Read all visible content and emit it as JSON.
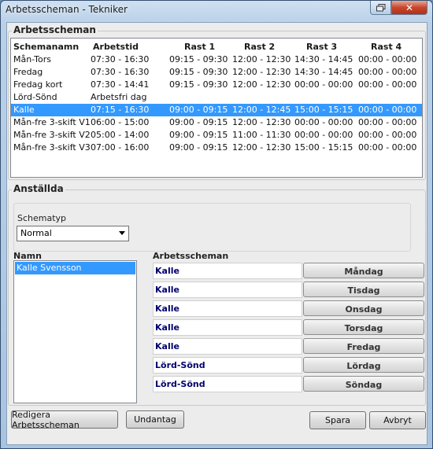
{
  "window": {
    "title": "Arbetsscheman - Tekniker"
  },
  "schedules_group": {
    "title": "Arbetsscheman",
    "columns": [
      "Schemanamn",
      "Arbetstid",
      "Rast 1",
      "Rast 2",
      "Rast 3",
      "Rast 4"
    ],
    "rows": [
      [
        "Mån-Tors",
        "07:30 - 16:30",
        "09:15 - 09:30",
        "12:00 - 12:30",
        "14:30 - 14:45",
        "00:00 - 00:00"
      ],
      [
        "Fredag",
        "07:30 - 16:30",
        "09:15 - 09:30",
        "12:00 - 12:30",
        "14:30 - 14:45",
        "00:00 - 00:00"
      ],
      [
        "Fredag kort",
        "07:30 - 14:41",
        "09:15 - 09:30",
        "12:00 - 12:30",
        "00:00 - 00:00",
        "00:00 - 00:00"
      ],
      [
        "Lörd-Sönd",
        "Arbetsfri dag",
        "",
        "",
        "",
        ""
      ],
      [
        "Kalle",
        "07:15 - 16:30",
        "09:00 - 09:15",
        "12:00 - 12:45",
        "15:00 - 15:15",
        "00:00 - 00:00"
      ],
      [
        "Mån-fre 3-skift V1",
        "06:00 - 15:00",
        "09:00 - 09:15",
        "12:00 - 12:30",
        "00:00 - 00:00",
        "00:00 - 00:00"
      ],
      [
        "Mån-fre 3-skift V2",
        "05:00 - 14:00",
        "09:00 - 09:15",
        "11:00 - 11:30",
        "00:00 - 00:00",
        "00:00 - 00:00"
      ],
      [
        "Mån-fre 3-skift V3",
        "07:00 - 16:00",
        "09:00 - 09:15",
        "12:00 - 12:30",
        "15:00 - 15:15",
        "00:00 - 00:00"
      ]
    ],
    "selected_row": "Kalle"
  },
  "employees_group": {
    "title": "Anställda",
    "schematype_label": "Schematyp",
    "schematype_value": "Normal",
    "name_header": "Namn",
    "names": [
      "Kalle Svensson"
    ],
    "schedules_header": "Arbetsscheman",
    "days": [
      {
        "schedule": "Kalle",
        "day": "Måndag"
      },
      {
        "schedule": "Kalle",
        "day": "Tisdag"
      },
      {
        "schedule": "Kalle",
        "day": "Onsdag"
      },
      {
        "schedule": "Kalle",
        "day": "Torsdag"
      },
      {
        "schedule": "Kalle",
        "day": "Fredag"
      },
      {
        "schedule": "Lörd-Sönd",
        "day": "Lördag"
      },
      {
        "schedule": "Lörd-Sönd",
        "day": "Söndag"
      }
    ]
  },
  "buttons": {
    "edit": "Redigera Arbetsscheman",
    "exceptions": "Undantag",
    "save": "Spara",
    "cancel": "Avbryt"
  },
  "icons": {
    "restore": "restore-icon",
    "close": "close-icon"
  },
  "colors": {
    "selection": "#3399ff",
    "schedule_text": "#00006e"
  }
}
